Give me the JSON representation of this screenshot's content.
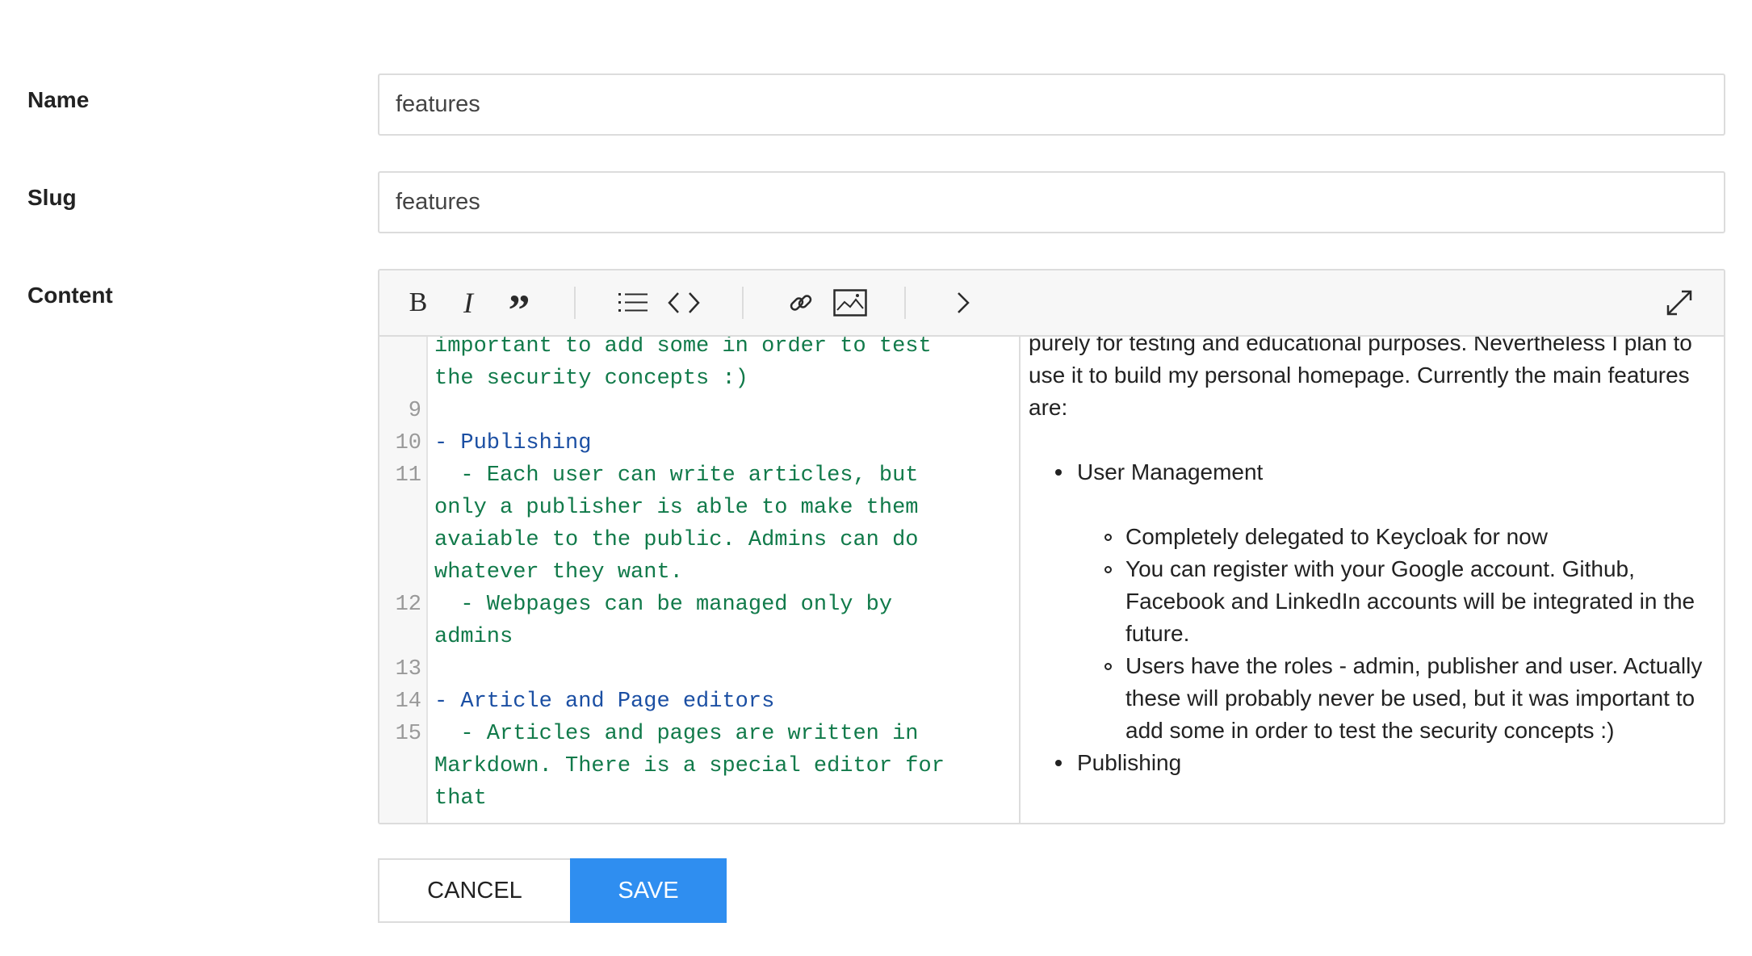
{
  "form": {
    "name_label": "Name",
    "name_value": "features",
    "slug_label": "Slug",
    "slug_value": "features",
    "content_label": "Content"
  },
  "toolbar": {
    "buttons": [
      {
        "name": "bold",
        "icon": "bold-icon"
      },
      {
        "name": "italic",
        "icon": "italic-icon"
      },
      {
        "name": "quote",
        "icon": "quote-icon"
      },
      {
        "name": "unordered-list",
        "icon": "list-icon"
      },
      {
        "name": "code",
        "icon": "code-icon"
      },
      {
        "name": "link",
        "icon": "link-icon"
      },
      {
        "name": "image",
        "icon": "image-icon"
      },
      {
        "name": "preview",
        "icon": "chevron-right-icon"
      },
      {
        "name": "fullscreen",
        "icon": "expand-icon"
      }
    ]
  },
  "code": {
    "lines": [
      {
        "num": "",
        "text": "important to add some in order to test",
        "color": "green"
      },
      {
        "num": "",
        "text": "the security concepts :)",
        "color": "green"
      },
      {
        "num": "9",
        "text": "",
        "color": "green"
      },
      {
        "num": "10",
        "text": "- Publishing",
        "color": "blue"
      },
      {
        "num": "11",
        "text": "  - Each user can write articles, but",
        "color": "green"
      },
      {
        "num": "",
        "text": "only a publisher is able to make them",
        "color": "green"
      },
      {
        "num": "",
        "text": "avaiable to the public. Admins can do",
        "color": "green"
      },
      {
        "num": "",
        "text": "whatever they want.",
        "color": "green"
      },
      {
        "num": "12",
        "text": "  - Webpages can be managed only by",
        "color": "green"
      },
      {
        "num": "",
        "text": "admins",
        "color": "green"
      },
      {
        "num": "13",
        "text": "",
        "color": "green"
      },
      {
        "num": "14",
        "text": "- Article and Page editors",
        "color": "blue"
      },
      {
        "num": "15",
        "text": "  - Articles and pages are written in",
        "color": "green"
      },
      {
        "num": "",
        "text": "Markdown. There is a special editor for",
        "color": "green"
      },
      {
        "num": "",
        "text": "that",
        "color": "green"
      }
    ]
  },
  "preview": {
    "intro_lines": [
      "purely for testing and educational purposes. Nevertheless I plan to",
      "use it to build my personal homepage. Currently the main features",
      "are:"
    ],
    "item1": "User Management",
    "sub1": "Completely delegated to Keycloak for now",
    "sub2_lines": [
      "You can register with your Google account. Github,",
      "Facebook and LinkedIn accounts will be integrated in the",
      "future."
    ],
    "sub3_lines": [
      "Users have the roles - admin, publisher and user. Actually",
      "these will probably never be used, but it was important to",
      "add some in order to test the security concepts :)"
    ],
    "item2": "Publishing"
  },
  "actions": {
    "cancel_label": "CANCEL",
    "save_label": "SAVE"
  },
  "colors": {
    "primary": "#2f8ef0",
    "code_green": "#117a4a",
    "code_blue": "#1b4fa3"
  }
}
